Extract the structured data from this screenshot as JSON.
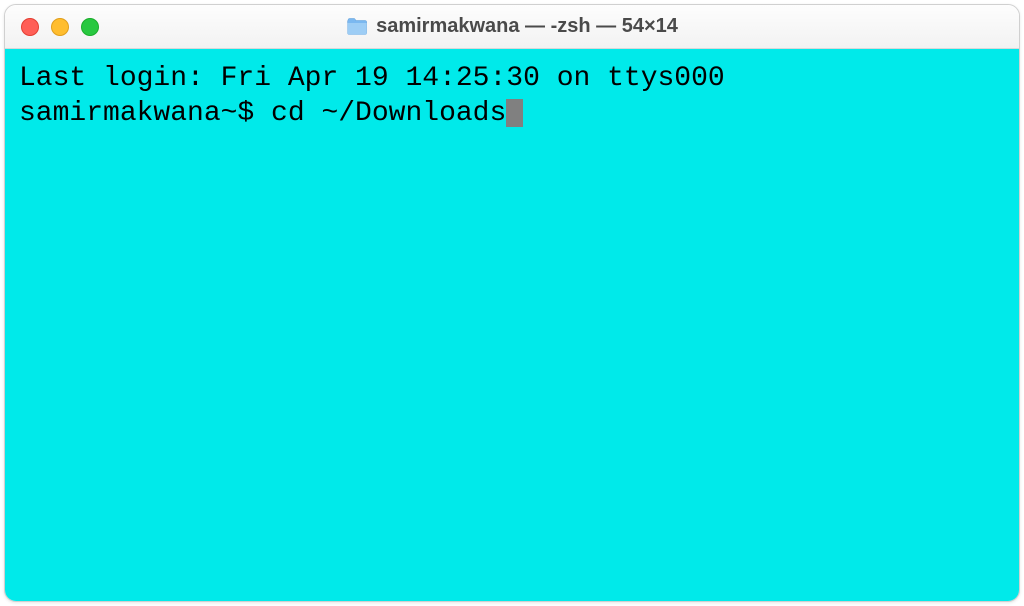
{
  "window": {
    "title": "samirmakwana — -zsh — 54×14"
  },
  "terminal": {
    "background": "#00eaea",
    "foreground": "#000000",
    "lines": {
      "last_login": "Last login: Fri Apr 19 14:25:30 on ttys000",
      "prompt": "samirmakwana~$ ",
      "command": "cd ~/Downloads"
    }
  },
  "colors": {
    "close": "#ff5f57",
    "minimize": "#ffbd2e",
    "zoom": "#28c840"
  }
}
